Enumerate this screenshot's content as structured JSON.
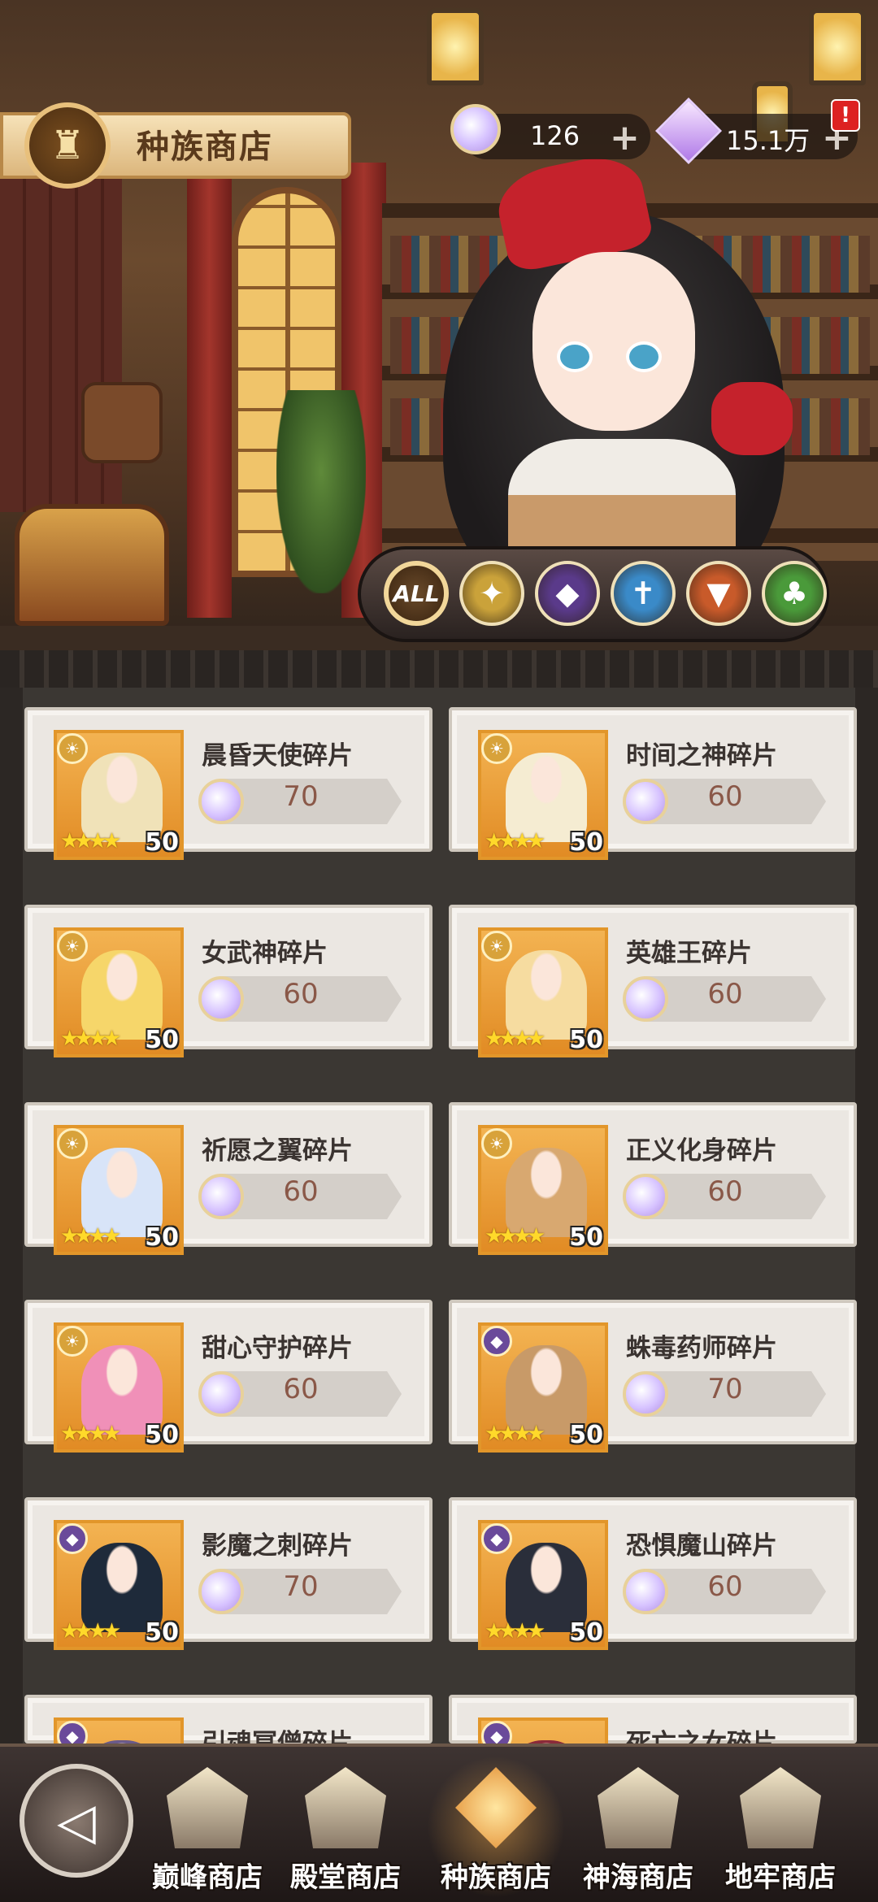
{
  "header": {
    "shop_title": "种族商店",
    "currency_crystal": "126",
    "currency_diamond": "15.1万",
    "plus": "+",
    "alert": "!"
  },
  "factions": [
    {
      "label": "ALL",
      "icon": "all-icon",
      "color": "#5a3a1a",
      "active": true
    },
    {
      "label": "✦",
      "icon": "light-faction-icon",
      "color": "#caa23a"
    },
    {
      "label": "◆",
      "icon": "dark-faction-icon",
      "color": "#5a3a8a"
    },
    {
      "label": "✝",
      "icon": "holy-faction-icon",
      "color": "#3a8ac8"
    },
    {
      "label": "▼",
      "icon": "wolf-faction-icon",
      "color": "#c85a2a"
    },
    {
      "label": "♣",
      "icon": "tree-faction-icon",
      "color": "#4a9a3a"
    }
  ],
  "items": [
    {
      "name": "晨昏天使碎片",
      "price": "70",
      "level": "50",
      "stars": "★★★★",
      "faction": "☀",
      "hair": "#f0e2b8"
    },
    {
      "name": "时间之神碎片",
      "price": "60",
      "level": "50",
      "stars": "★★★★",
      "faction": "☀",
      "hair": "#f5ecd2"
    },
    {
      "name": "女武神碎片",
      "price": "60",
      "level": "50",
      "stars": "★★★★",
      "faction": "☀",
      "hair": "#f6d66a"
    },
    {
      "name": "英雄王碎片",
      "price": "60",
      "level": "50",
      "stars": "★★★★",
      "faction": "☀",
      "hair": "#f6dca0"
    },
    {
      "name": "祈愿之翼碎片",
      "price": "60",
      "level": "50",
      "stars": "★★★★",
      "faction": "☀",
      "hair": "#d8e4f8"
    },
    {
      "name": "正义化身碎片",
      "price": "60",
      "level": "50",
      "stars": "★★★★",
      "faction": "☀",
      "hair": "#d8a870"
    },
    {
      "name": "甜心守护碎片",
      "price": "60",
      "level": "50",
      "stars": "★★★★",
      "faction": "☀",
      "hair": "#f090b8"
    },
    {
      "name": "蛛毒药师碎片",
      "price": "70",
      "level": "50",
      "stars": "★★★★",
      "faction": "◆",
      "hair": "#c89a68"
    },
    {
      "name": "影魔之刺碎片",
      "price": "70",
      "level": "50",
      "stars": "★★★★",
      "faction": "◆",
      "hair": "#1e2a3a"
    },
    {
      "name": "恐惧魔山碎片",
      "price": "60",
      "level": "50",
      "stars": "★★★★",
      "faction": "◆",
      "hair": "#2a2e3a"
    },
    {
      "name": "引魂冥僧碎片",
      "price": "",
      "level": "",
      "stars": "",
      "faction": "◆",
      "hair": "#6a5a8a"
    },
    {
      "name": "死亡之女碎片",
      "price": "",
      "level": "",
      "stars": "",
      "faction": "◆",
      "hair": "#8a2a3a"
    }
  ],
  "nav": {
    "back": "◁",
    "tabs": [
      {
        "label": "巅峰商店"
      },
      {
        "label": "殿堂商店"
      },
      {
        "label": "种族商店"
      },
      {
        "label": "神海商店"
      },
      {
        "label": "地牢商店"
      }
    ]
  }
}
